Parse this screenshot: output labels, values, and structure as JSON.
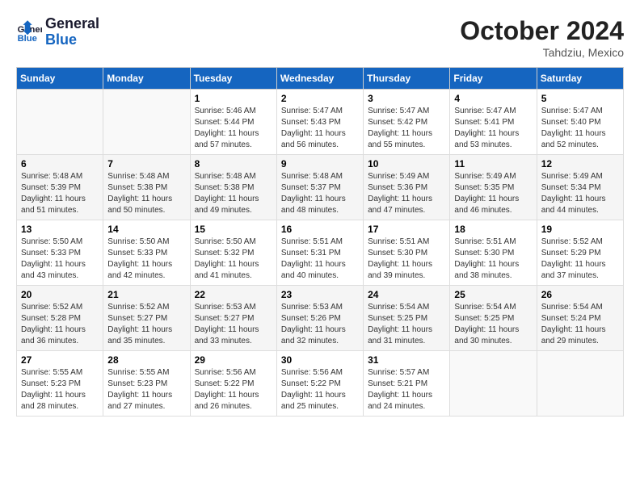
{
  "header": {
    "logo_general": "General",
    "logo_blue": "Blue",
    "month": "October 2024",
    "location": "Tahdziu, Mexico"
  },
  "days_of_week": [
    "Sunday",
    "Monday",
    "Tuesday",
    "Wednesday",
    "Thursday",
    "Friday",
    "Saturday"
  ],
  "weeks": [
    [
      {
        "day": "",
        "info": ""
      },
      {
        "day": "",
        "info": ""
      },
      {
        "day": "1",
        "info": "Sunrise: 5:46 AM\nSunset: 5:44 PM\nDaylight: 11 hours and 57 minutes."
      },
      {
        "day": "2",
        "info": "Sunrise: 5:47 AM\nSunset: 5:43 PM\nDaylight: 11 hours and 56 minutes."
      },
      {
        "day": "3",
        "info": "Sunrise: 5:47 AM\nSunset: 5:42 PM\nDaylight: 11 hours and 55 minutes."
      },
      {
        "day": "4",
        "info": "Sunrise: 5:47 AM\nSunset: 5:41 PM\nDaylight: 11 hours and 53 minutes."
      },
      {
        "day": "5",
        "info": "Sunrise: 5:47 AM\nSunset: 5:40 PM\nDaylight: 11 hours and 52 minutes."
      }
    ],
    [
      {
        "day": "6",
        "info": "Sunrise: 5:48 AM\nSunset: 5:39 PM\nDaylight: 11 hours and 51 minutes."
      },
      {
        "day": "7",
        "info": "Sunrise: 5:48 AM\nSunset: 5:38 PM\nDaylight: 11 hours and 50 minutes."
      },
      {
        "day": "8",
        "info": "Sunrise: 5:48 AM\nSunset: 5:38 PM\nDaylight: 11 hours and 49 minutes."
      },
      {
        "day": "9",
        "info": "Sunrise: 5:48 AM\nSunset: 5:37 PM\nDaylight: 11 hours and 48 minutes."
      },
      {
        "day": "10",
        "info": "Sunrise: 5:49 AM\nSunset: 5:36 PM\nDaylight: 11 hours and 47 minutes."
      },
      {
        "day": "11",
        "info": "Sunrise: 5:49 AM\nSunset: 5:35 PM\nDaylight: 11 hours and 46 minutes."
      },
      {
        "day": "12",
        "info": "Sunrise: 5:49 AM\nSunset: 5:34 PM\nDaylight: 11 hours and 44 minutes."
      }
    ],
    [
      {
        "day": "13",
        "info": "Sunrise: 5:50 AM\nSunset: 5:33 PM\nDaylight: 11 hours and 43 minutes."
      },
      {
        "day": "14",
        "info": "Sunrise: 5:50 AM\nSunset: 5:33 PM\nDaylight: 11 hours and 42 minutes."
      },
      {
        "day": "15",
        "info": "Sunrise: 5:50 AM\nSunset: 5:32 PM\nDaylight: 11 hours and 41 minutes."
      },
      {
        "day": "16",
        "info": "Sunrise: 5:51 AM\nSunset: 5:31 PM\nDaylight: 11 hours and 40 minutes."
      },
      {
        "day": "17",
        "info": "Sunrise: 5:51 AM\nSunset: 5:30 PM\nDaylight: 11 hours and 39 minutes."
      },
      {
        "day": "18",
        "info": "Sunrise: 5:51 AM\nSunset: 5:30 PM\nDaylight: 11 hours and 38 minutes."
      },
      {
        "day": "19",
        "info": "Sunrise: 5:52 AM\nSunset: 5:29 PM\nDaylight: 11 hours and 37 minutes."
      }
    ],
    [
      {
        "day": "20",
        "info": "Sunrise: 5:52 AM\nSunset: 5:28 PM\nDaylight: 11 hours and 36 minutes."
      },
      {
        "day": "21",
        "info": "Sunrise: 5:52 AM\nSunset: 5:27 PM\nDaylight: 11 hours and 35 minutes."
      },
      {
        "day": "22",
        "info": "Sunrise: 5:53 AM\nSunset: 5:27 PM\nDaylight: 11 hours and 33 minutes."
      },
      {
        "day": "23",
        "info": "Sunrise: 5:53 AM\nSunset: 5:26 PM\nDaylight: 11 hours and 32 minutes."
      },
      {
        "day": "24",
        "info": "Sunrise: 5:54 AM\nSunset: 5:25 PM\nDaylight: 11 hours and 31 minutes."
      },
      {
        "day": "25",
        "info": "Sunrise: 5:54 AM\nSunset: 5:25 PM\nDaylight: 11 hours and 30 minutes."
      },
      {
        "day": "26",
        "info": "Sunrise: 5:54 AM\nSunset: 5:24 PM\nDaylight: 11 hours and 29 minutes."
      }
    ],
    [
      {
        "day": "27",
        "info": "Sunrise: 5:55 AM\nSunset: 5:23 PM\nDaylight: 11 hours and 28 minutes."
      },
      {
        "day": "28",
        "info": "Sunrise: 5:55 AM\nSunset: 5:23 PM\nDaylight: 11 hours and 27 minutes."
      },
      {
        "day": "29",
        "info": "Sunrise: 5:56 AM\nSunset: 5:22 PM\nDaylight: 11 hours and 26 minutes."
      },
      {
        "day": "30",
        "info": "Sunrise: 5:56 AM\nSunset: 5:22 PM\nDaylight: 11 hours and 25 minutes."
      },
      {
        "day": "31",
        "info": "Sunrise: 5:57 AM\nSunset: 5:21 PM\nDaylight: 11 hours and 24 minutes."
      },
      {
        "day": "",
        "info": ""
      },
      {
        "day": "",
        "info": ""
      }
    ]
  ]
}
